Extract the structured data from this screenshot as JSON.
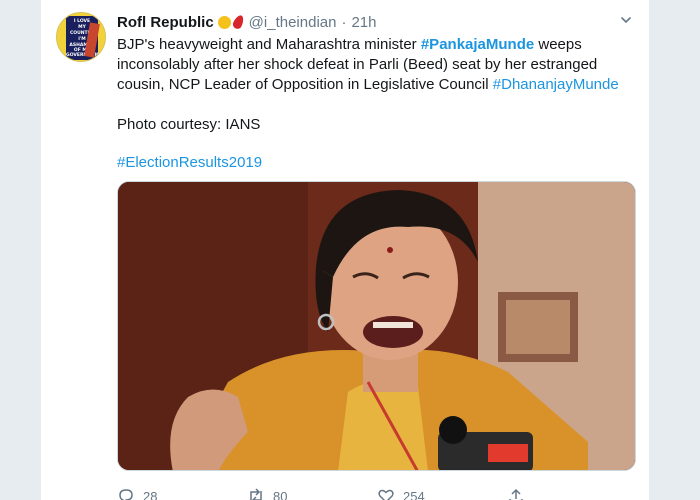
{
  "tweet": {
    "author_name": "Rofl Republic",
    "author_handle": "@i_theindian",
    "separator": "·",
    "timestamp": "21h",
    "text_part1": "BJP's heavyweight and Maharashtra minister ",
    "hashtag1": "#PankajaMunde",
    "text_part2": " weeps inconsolably after her shock defeat in Parli (Beed) seat by her estranged cousin, NCP Leader of Opposition in Legislative Council ",
    "hashtag2": "#DhananjayMunde",
    "photo_credit": "Photo courtesy: IANS",
    "hashtag3": "#ElectionResults2019",
    "avatar_text": [
      "I LOVE",
      "MY",
      "COUNTRY",
      "I'M",
      "ASHAMED",
      "OF MY",
      "GOVERNMENT"
    ],
    "emoji_icons": [
      "lemon-icon",
      "chili-pepper-icon"
    ]
  },
  "actions": {
    "reply_count": "28",
    "retweet_count": "80",
    "like_count": "254"
  },
  "colors": {
    "hashtag": "#1b95e0",
    "muted": "#657786",
    "background": "#e6ecf0"
  }
}
